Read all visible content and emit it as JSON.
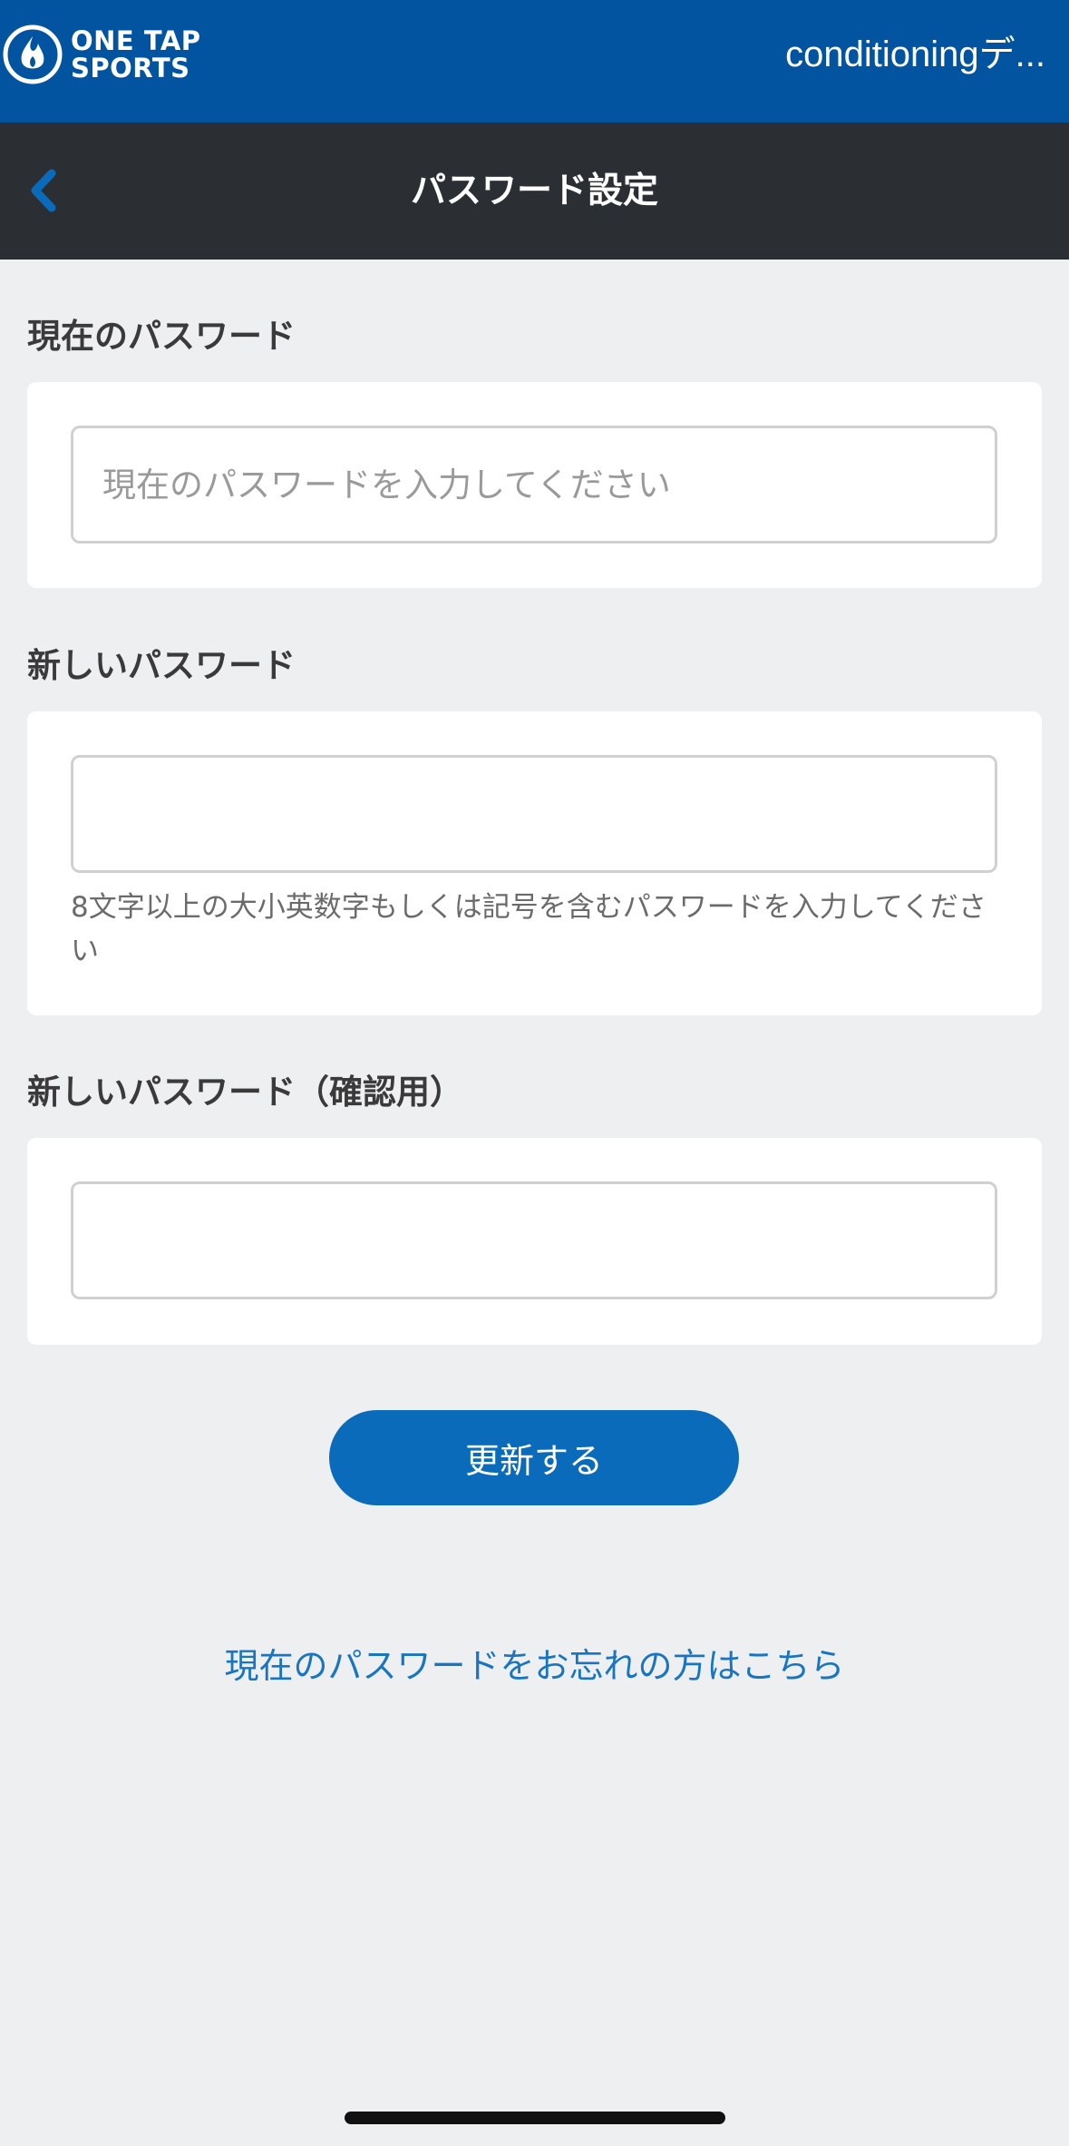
{
  "header": {
    "logo_line1": "ONE TAP",
    "logo_line2": "SPORTS",
    "user_name": "conditioningデ...",
    "brand_color": "#0254a1"
  },
  "navbar": {
    "title": "パスワード設定",
    "back_icon": "chevron-left-icon",
    "accent_color": "#0a6bba"
  },
  "form": {
    "current_password": {
      "label": "現在のパスワード",
      "placeholder": "現在のパスワードを入力してください",
      "value": ""
    },
    "new_password": {
      "label": "新しいパスワード",
      "placeholder": "",
      "value": "",
      "hint": "8文字以上の大小英数字もしくは記号を含むパスワードを入力してください"
    },
    "confirm_password": {
      "label": "新しいパスワード（確認用）",
      "placeholder": "",
      "value": ""
    },
    "submit_label": "更新する",
    "forgot_link": "現在のパスワードをお忘れの方はこちら"
  }
}
